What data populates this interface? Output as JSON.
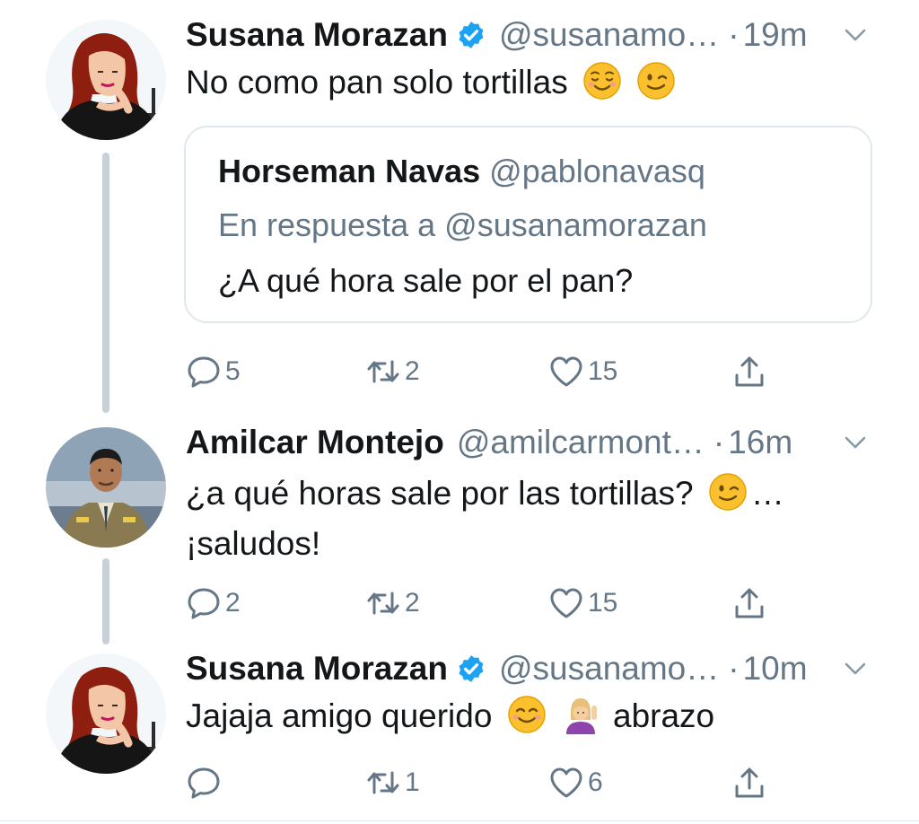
{
  "tweets": [
    {
      "name": "Susana Morazan",
      "verified": true,
      "handle": "@susanamo…",
      "dot": "·",
      "time": "19m",
      "text": "No como pan solo tortillas",
      "emojis": [
        "relieved-face-emoji",
        "winking-face-emoji"
      ],
      "quoted": {
        "name": "Horseman Navas",
        "handle": "@pablonavasq",
        "reply_to": "En respuesta a @susanamorazan",
        "text": "¿A qué hora sale por el pan?"
      },
      "replies": "5",
      "retweets": "2",
      "likes": "15"
    },
    {
      "name": "Amilcar Montejo",
      "verified": false,
      "handle": "@amilcarmont…",
      "dot": "·",
      "time": "16m",
      "text_line1": "¿a qué horas sale por las tortillas?",
      "text_line1_suffix": "…",
      "text_line2": "¡saludos!",
      "emojis": [
        "winking-face-emoji"
      ],
      "replies": "2",
      "retweets": "2",
      "likes": "15"
    },
    {
      "name": "Susana Morazan",
      "verified": true,
      "handle": "@susanamo…",
      "dot": "·",
      "time": "10m",
      "text": "Jajaja amigo querido",
      "text_suffix": "abrazo",
      "emojis": [
        "smiling-face-emoji",
        "woman-tipping-hand-emoji"
      ],
      "replies": "",
      "retweets": "1",
      "likes": "6"
    }
  ],
  "colors": {
    "text": "#14171a",
    "muted": "#657786",
    "verified": "#1da1f2",
    "thread_line": "#c8d1d9",
    "border": "#e1e8ed"
  }
}
